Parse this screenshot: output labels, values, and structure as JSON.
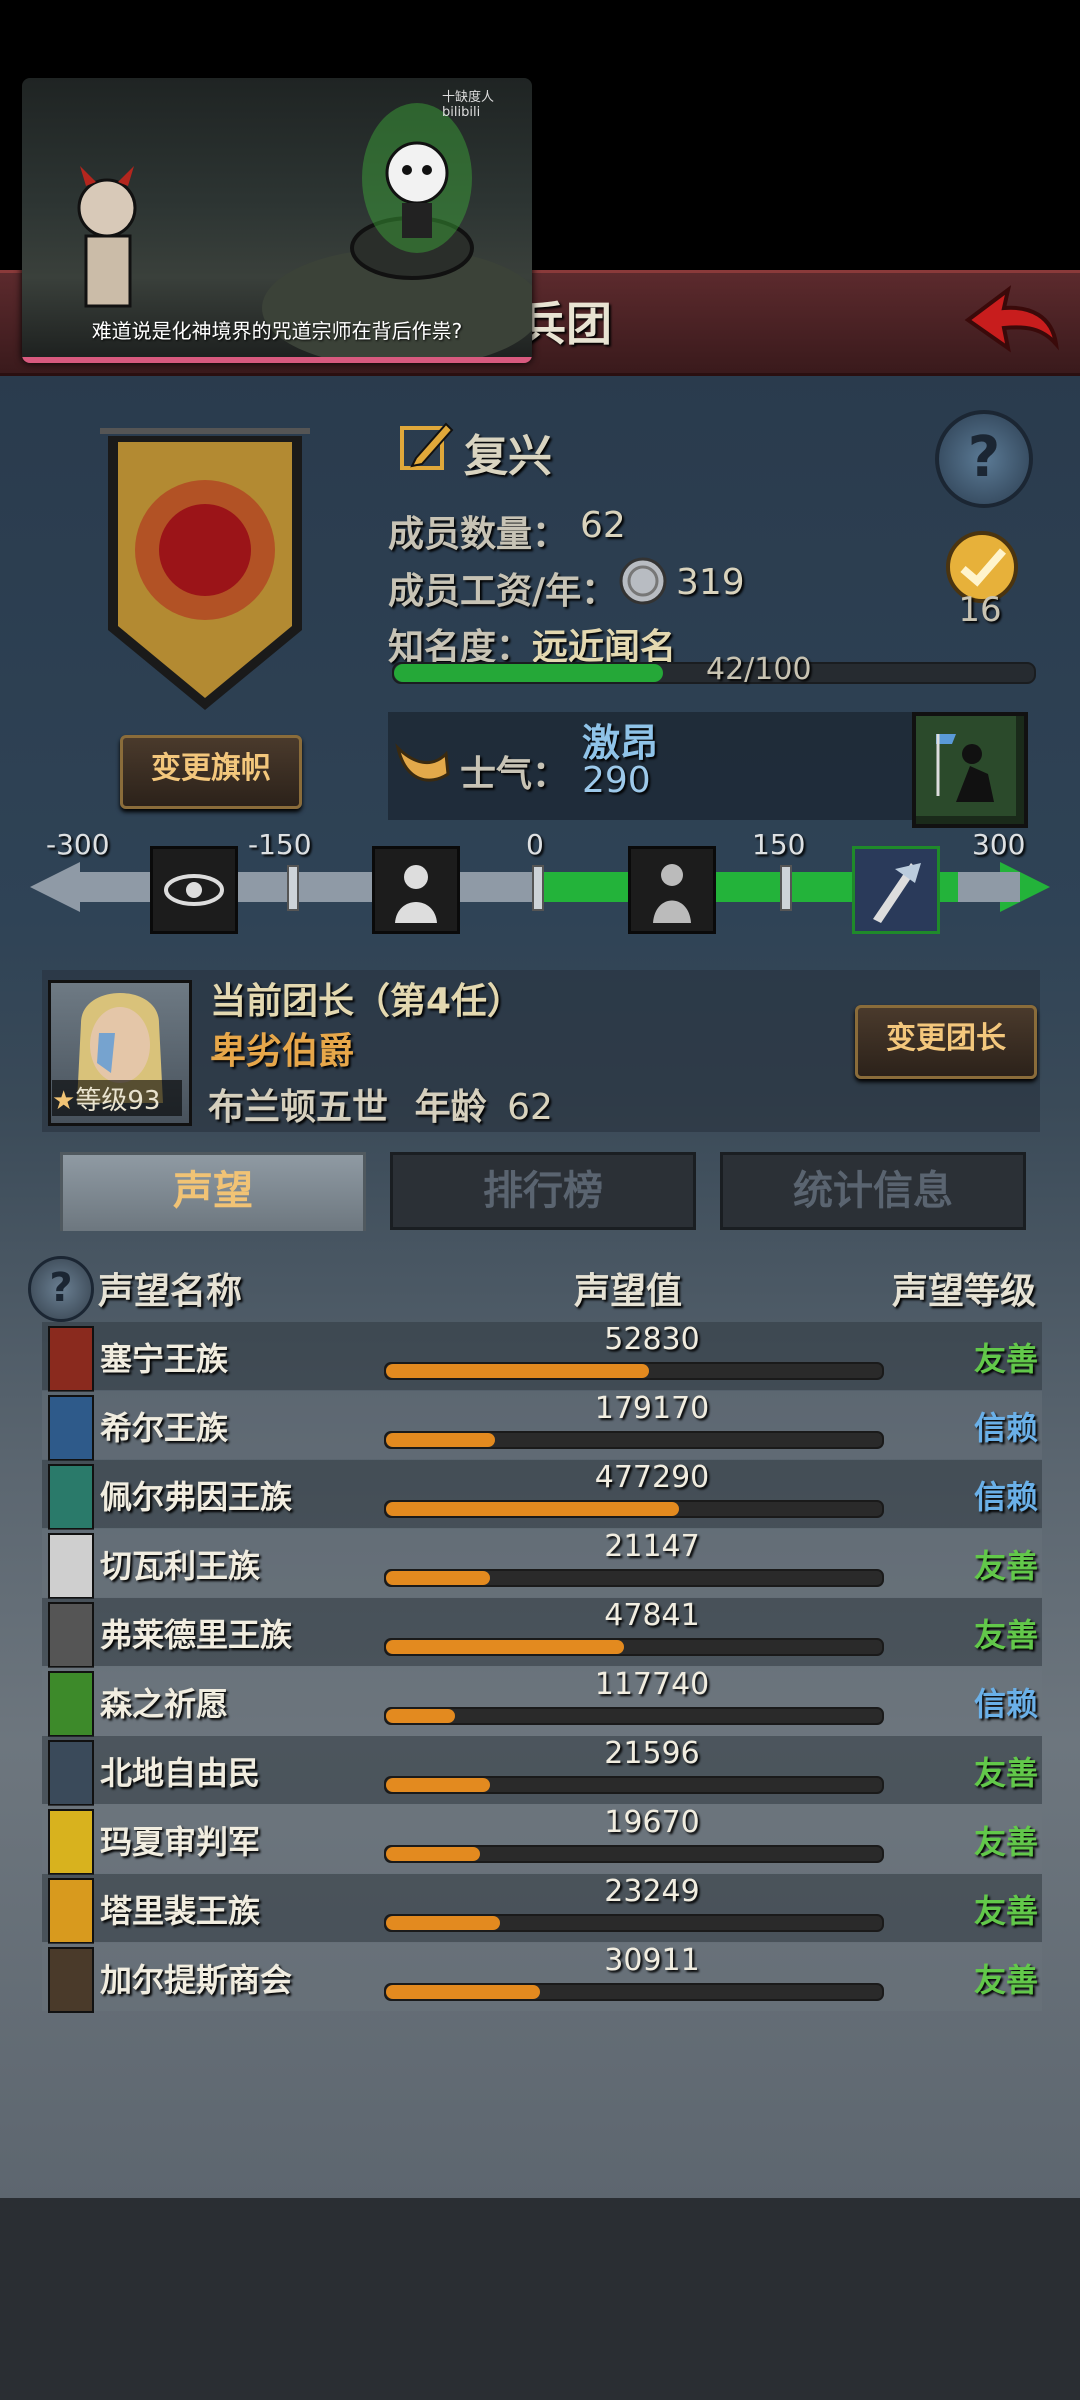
{
  "header": {
    "title": "兵团"
  },
  "video": {
    "caption": "难道说是化神境界的咒道宗师在背后作祟?",
    "watermark": "十缺度人 bilibili"
  },
  "group": {
    "name": "复兴",
    "member_count_label": "成员数量：",
    "member_count": "62",
    "salary_label": "成员工资/年：",
    "salary": "319",
    "fame_label": "知名度：",
    "fame_status": "远近闻名",
    "fame_value": "42/100",
    "fame_progress": 0.42,
    "rank_value": "16",
    "change_flag_label": "变更旗帜"
  },
  "morale": {
    "label": "士气：",
    "status": "激昂",
    "value": "290",
    "scale_ticks": [
      "-300",
      "-150",
      "0",
      "150",
      "300"
    ]
  },
  "commander": {
    "title": "当前团长（第4任）",
    "rank": "卑劣伯爵",
    "name": "布兰顿五世",
    "age_label": "年龄",
    "age": "62",
    "level_label": "等级",
    "level": "93",
    "change_leader_label": "变更团长"
  },
  "tabs": [
    "声望",
    "排行榜",
    "统计信息"
  ],
  "reputation": {
    "columns": [
      "声望名称",
      "声望值",
      "声望等级"
    ],
    "rows": [
      {
        "name": "塞宁王族",
        "value": "52830",
        "level": "友善",
        "progress": 0.53,
        "icon_color": "#8a2a1e"
      },
      {
        "name": "希尔王族",
        "value": "179170",
        "level": "信赖",
        "progress": 0.22,
        "icon_color": "#2e5a8a"
      },
      {
        "name": "佩尔弗因王族",
        "value": "477290",
        "level": "信赖",
        "progress": 0.59,
        "icon_color": "#2a7a6a"
      },
      {
        "name": "切瓦利王族",
        "value": "21147",
        "level": "友善",
        "progress": 0.21,
        "icon_color": "#cfcfcf"
      },
      {
        "name": "弗莱德里王族",
        "value": "47841",
        "level": "友善",
        "progress": 0.48,
        "icon_color": "#555555"
      },
      {
        "name": "森之祈愿",
        "value": "117740",
        "level": "信赖",
        "progress": 0.14,
        "icon_color": "#3d8a2a"
      },
      {
        "name": "北地自由民",
        "value": "21596",
        "level": "友善",
        "progress": 0.21,
        "icon_color": "#3a4a5a"
      },
      {
        "name": "玛夏审判军",
        "value": "19670",
        "level": "友善",
        "progress": 0.19,
        "icon_color": "#d8b21e"
      },
      {
        "name": "塔里裴王族",
        "value": "23249",
        "level": "友善",
        "progress": 0.23,
        "icon_color": "#d89a1e"
      },
      {
        "name": "加尔提斯商会",
        "value": "30911",
        "level": "友善",
        "progress": 0.31,
        "icon_color": "#4a3a2a"
      }
    ]
  },
  "colors": {
    "level_friendly": "#62c84a",
    "level_trust": "#6ab0e8",
    "accent": "#f1c375"
  }
}
